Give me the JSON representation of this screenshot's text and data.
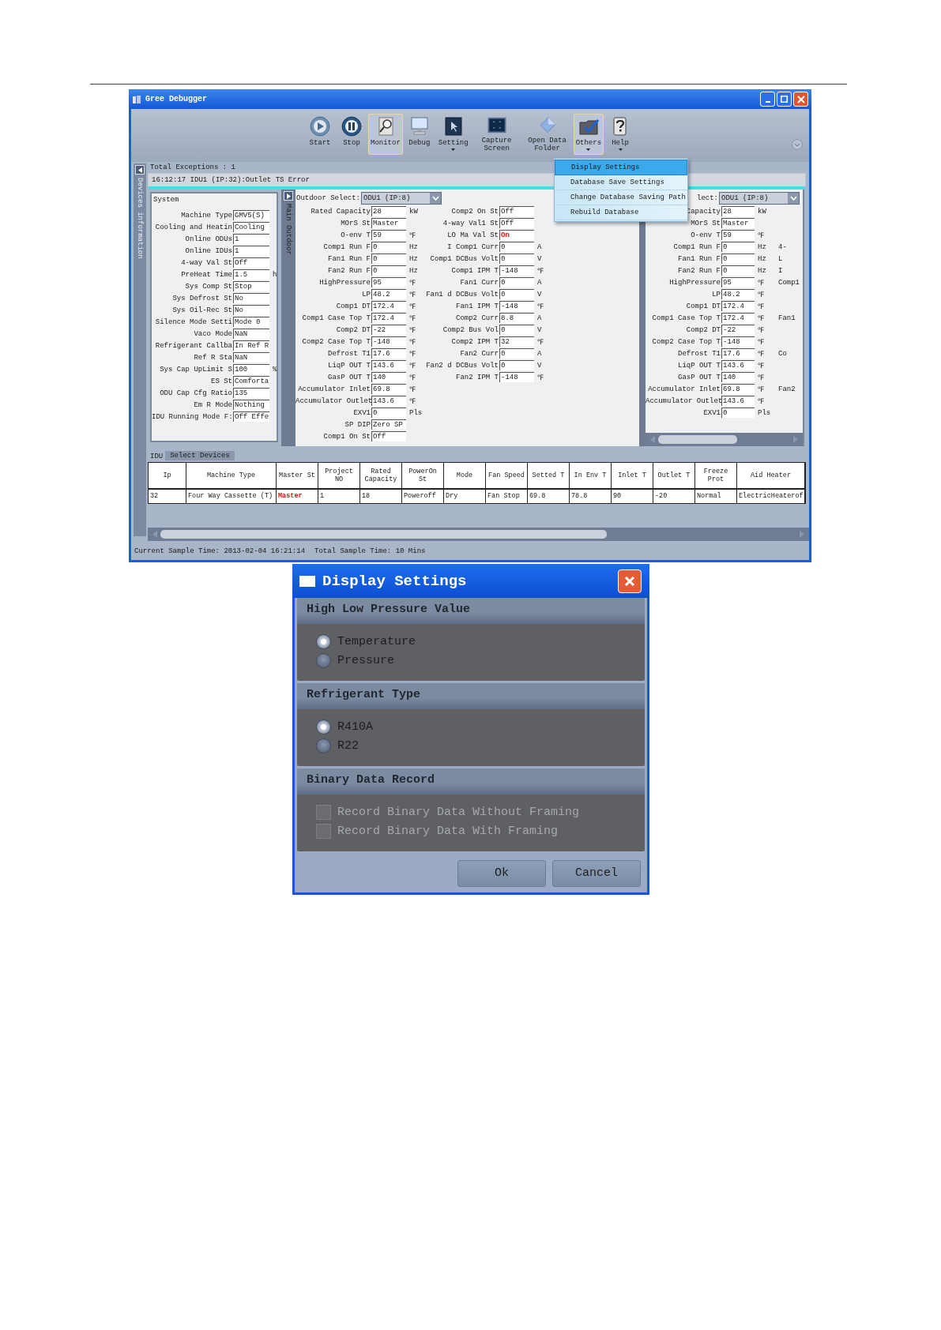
{
  "window": {
    "title": "Gree Debugger"
  },
  "toolbar": [
    {
      "label": "Start",
      "selected": false,
      "has_menu": false
    },
    {
      "label": "Stop",
      "selected": false,
      "has_menu": false
    },
    {
      "label": "Monitor",
      "selected": true,
      "has_menu": false
    },
    {
      "label": "Debug",
      "selected": false,
      "has_menu": false
    },
    {
      "label": "Setting",
      "selected": false,
      "has_menu": true
    },
    {
      "label": "Capture Screen",
      "selected": false,
      "has_menu": false
    },
    {
      "label": "Open Data Folder",
      "selected": false,
      "has_menu": false
    },
    {
      "label": "Others",
      "selected": true,
      "has_menu": true
    },
    {
      "label": "Help",
      "selected": false,
      "has_menu": true
    }
  ],
  "menu": [
    {
      "label": "Display Settings",
      "selected": true
    },
    {
      "label": "Database Save Settings",
      "selected": false
    },
    {
      "label": "Change Database Saving Path",
      "selected": false
    },
    {
      "label": "Rebuild Database",
      "selected": false
    }
  ],
  "side_tab": "Devices information",
  "exceptions": {
    "total": "Total Exceptions : 1",
    "messages": [
      "16:12:17 IDU1 (IP:32):Outlet TS Error"
    ]
  },
  "system_panel": {
    "title": "System",
    "fields": [
      {
        "label": "Machine Type",
        "value": "GMV5(S)",
        "alert": false
      },
      {
        "label": "Cooling and Heatin",
        "value": "Cooling",
        "alert": false
      },
      {
        "label": "Online ODUs",
        "value": "1",
        "alert": false
      },
      {
        "label": "Online IDUs",
        "value": "1",
        "alert": false
      },
      {
        "label": "4-way Val St",
        "value": "Off",
        "alert": false
      },
      {
        "label": "PreHeat Time",
        "value": "1.5",
        "unit": "h",
        "alert": false
      },
      {
        "label": "Sys Comp St",
        "value": "Stop",
        "alert": false
      },
      {
        "label": "Sys Defrost St",
        "value": "No",
        "alert": false
      },
      {
        "label": "Sys Oil-Rec St",
        "value": "No",
        "alert": false
      },
      {
        "label": "Silence Mode Setti",
        "value": "Mode 0",
        "alert": false
      },
      {
        "label": "Vaco Mode",
        "value": "NaN",
        "alert": false
      },
      {
        "label": "Refrigerant Callba",
        "value": "In Ref R",
        "alert": false
      },
      {
        "label": "Ref R Sta",
        "value": "NaN",
        "alert": false
      },
      {
        "label": "Sys Cap UpLimit S",
        "value": "100",
        "unit": "%",
        "alert": false
      },
      {
        "label": "ES St",
        "value": "Comforta",
        "alert": false
      },
      {
        "label": "ODU Cap Cfg Ratio",
        "value": "135",
        "alert": false
      },
      {
        "label": "Em R Mode",
        "value": "Nothing",
        "alert": false
      },
      {
        "label": "IDU Running Mode F:",
        "value": "Off Effe",
        "alert": false
      }
    ]
  },
  "outdoor_panel": {
    "side_tab": "Main Outdoor",
    "select_label": "Outdoor Select:",
    "select_value": "ODU1 (IP:8)",
    "column_1": [
      {
        "label": "Rated Capacity",
        "value": "28",
        "unit": "kW",
        "alert": false
      },
      {
        "label": "MOrS St",
        "value": "Master",
        "alert": false
      },
      {
        "label": "O-env T",
        "value": "59",
        "unit": "℉",
        "alert": false
      },
      {
        "label": "Comp1 Run F",
        "value": "0",
        "unit": "Hz",
        "alert": false
      },
      {
        "label": "Fan1 Run F",
        "value": "0",
        "unit": "Hz",
        "alert": false
      },
      {
        "label": "Fan2 Run F",
        "value": "0",
        "unit": "Hz",
        "alert": false
      },
      {
        "label": "HighPressure",
        "value": "95",
        "unit": "℉",
        "alert": false
      },
      {
        "label": "LP",
        "value": "48.2",
        "unit": "℉",
        "alert": false
      },
      {
        "label": "Comp1 DT",
        "value": "172.4",
        "unit": "℉",
        "alert": false
      },
      {
        "label": "Comp1 Case Top T",
        "value": "172.4",
        "unit": "℉",
        "alert": false
      },
      {
        "label": "Comp2 DT",
        "value": "-22",
        "unit": "℉",
        "alert": false
      },
      {
        "label": "Comp2 Case Top T",
        "value": "-148",
        "unit": "℉",
        "alert": false
      },
      {
        "label": "Defrost T1",
        "value": "17.6",
        "unit": "℉",
        "alert": false
      },
      {
        "label": "LiqP OUT T",
        "value": "143.6",
        "unit": "℉",
        "alert": false
      },
      {
        "label": "GasP OUT T",
        "value": "140",
        "unit": "℉",
        "alert": false
      },
      {
        "label": "Accumulator Inlet",
        "value": "69.8",
        "unit": "℉",
        "alert": false
      },
      {
        "label": "Accumulator Outlet",
        "value": "143.6",
        "unit": "℉",
        "alert": false
      },
      {
        "label": "EXV1",
        "value": "0",
        "unit": "Pls",
        "alert": false
      },
      {
        "label": "SP DIP",
        "value": "Zero SP",
        "alert": false
      },
      {
        "label": "Comp1 On St",
        "value": "Off",
        "alert": false
      }
    ],
    "column_2": [
      {
        "label": "Comp2 On St",
        "value": "Off",
        "alert": false
      },
      {
        "label": "4-way Val1 St",
        "value": "Off",
        "alert": false
      },
      {
        "label": "LO Ma Val St",
        "value": "On",
        "alert": true
      },
      {
        "label": "I Comp1 Curr",
        "value": "0",
        "unit": "A",
        "alert": false
      },
      {
        "label": "Comp1 DCBus Volt",
        "value": "0",
        "unit": "V",
        "alert": false
      },
      {
        "label": "Comp1 IPM T",
        "value": "-148",
        "unit": "℉",
        "alert": false
      },
      {
        "label": "Fan1 Curr",
        "value": "0",
        "unit": "A",
        "alert": false
      },
      {
        "label": "Fan1 d DCBus Volt",
        "value": "0",
        "unit": "V",
        "alert": false
      },
      {
        "label": "Fan1 IPM T",
        "value": "-148",
        "unit": "℉",
        "alert": false
      },
      {
        "label": "Comp2 Curr",
        "value": "8.8",
        "unit": "A",
        "alert": false
      },
      {
        "label": "Comp2 Bus Vol",
        "value": "0",
        "unit": "V",
        "alert": false
      },
      {
        "label": "Comp2 IPM T",
        "value": "32",
        "unit": "℉",
        "alert": false
      },
      {
        "label": "Fan2 Curr",
        "value": "0",
        "unit": "A",
        "alert": false
      },
      {
        "label": "Fan2 d DCBus Volt",
        "value": "0",
        "unit": "V",
        "alert": false
      },
      {
        "label": "Fan2 IPM T",
        "value": "-148",
        "unit": "℉",
        "alert": false
      }
    ]
  },
  "outdoor_panel_2": {
    "select_label": "lect:",
    "select_value": "ODU1 (IP:8)",
    "fields": [
      {
        "label": "Capacity",
        "value": "28",
        "unit": "kW",
        "alert": false
      },
      {
        "label": "MOrS St",
        "value": "Master",
        "alert": false
      },
      {
        "label": "O-env T",
        "value": "59",
        "unit": "℉",
        "alert": false
      },
      {
        "label": "Comp1 Run F",
        "value": "0",
        "unit": "Hz",
        "alert": false,
        "next_label": "4-"
      },
      {
        "label": "Fan1 Run F",
        "value": "0",
        "unit": "Hz",
        "alert": false,
        "next_label": "L"
      },
      {
        "label": "Fan2 Run F",
        "value": "0",
        "unit": "Hz",
        "alert": false,
        "next_label": "I"
      },
      {
        "label": "HighPressure",
        "value": "95",
        "unit": "℉",
        "alert": false,
        "next_label": "Comp1"
      },
      {
        "label": "LP",
        "value": "48.2",
        "unit": "℉",
        "alert": false
      },
      {
        "label": "Comp1 DT",
        "value": "172.4",
        "unit": "℉",
        "alert": false
      },
      {
        "label": "Comp1 Case Top T",
        "value": "172.4",
        "unit": "℉",
        "alert": false,
        "next_label": "Fan1"
      },
      {
        "label": "Comp2 DT",
        "value": "-22",
        "unit": "℉",
        "alert": false
      },
      {
        "label": "Comp2 Case Top T",
        "value": "-148",
        "unit": "℉",
        "alert": false
      },
      {
        "label": "Defrost T1",
        "value": "17.6",
        "unit": "℉",
        "alert": false,
        "next_label": "Co"
      },
      {
        "label": "LiqP OUT T",
        "value": "143.6",
        "unit": "℉",
        "alert": false
      },
      {
        "label": "GasP OUT T",
        "value": "140",
        "unit": "℉",
        "alert": false
      },
      {
        "label": "Accumulator Inlet",
        "value": "69.8",
        "unit": "℉",
        "alert": false,
        "next_label": "Fan2"
      },
      {
        "label": "Accumulator Outlet",
        "value": "143.6",
        "unit": "℉",
        "alert": false
      },
      {
        "label": "EXV1",
        "value": "0",
        "unit": "Pls",
        "alert": false
      }
    ]
  },
  "idu": {
    "label": "IDU",
    "tabs": [
      {
        "label": "Select Devices",
        "selected": true
      }
    ],
    "columns": [
      "Ip",
      "Machine Type",
      "Master St",
      "Project NO",
      "Rated Capacity",
      "PowerOn St",
      "Mode",
      "Fan Speed",
      "Setted T",
      "In Env T",
      "Inlet T",
      "Outlet T",
      "Freeze Prot",
      "Aid Heater"
    ],
    "rows": [
      [
        {
          "text": "32",
          "alert": false
        },
        {
          "text": "Four Way Cassette (T)",
          "alert": false
        },
        {
          "text": "Master",
          "alert": true
        },
        {
          "text": "1",
          "alert": false
        },
        {
          "text": "18",
          "alert": false
        },
        {
          "text": "Poweroff",
          "alert": false
        },
        {
          "text": "Dry",
          "alert": false
        },
        {
          "text": "Fan Stop",
          "alert": false
        },
        {
          "text": "69.8",
          "alert": false
        },
        {
          "text": "78.8",
          "alert": false
        },
        {
          "text": "90",
          "alert": false
        },
        {
          "text": "-20",
          "alert": false
        },
        {
          "text": "Normal",
          "alert": false
        },
        {
          "text": "ElectricHeaterof",
          "alert": false
        }
      ]
    ]
  },
  "status_bar": [
    "Current Sample Time: 2013-02-04 16:21:14",
    "Total Sample Time: 10 Mins"
  ],
  "dialog": {
    "title": "Display Settings",
    "groups": [
      {
        "title": "High Low Pressure Value",
        "kind": "radio",
        "options": [
          {
            "label": "Temperature",
            "selected": true
          },
          {
            "label": "Pressure",
            "selected": false
          }
        ]
      },
      {
        "title": "Refrigerant Type",
        "kind": "radio",
        "options": [
          {
            "label": "R410A",
            "selected": true
          },
          {
            "label": "R22",
            "selected": false
          }
        ]
      },
      {
        "title": "Binary Data Record",
        "kind": "checkbox",
        "options": [
          {
            "label": "Record Binary Data Without Framing",
            "checked": false,
            "disabled": true
          },
          {
            "label": "Record Binary Data With Framing",
            "checked": false,
            "disabled": true
          }
        ]
      }
    ],
    "buttons": [
      "Ok",
      "Cancel"
    ]
  }
}
